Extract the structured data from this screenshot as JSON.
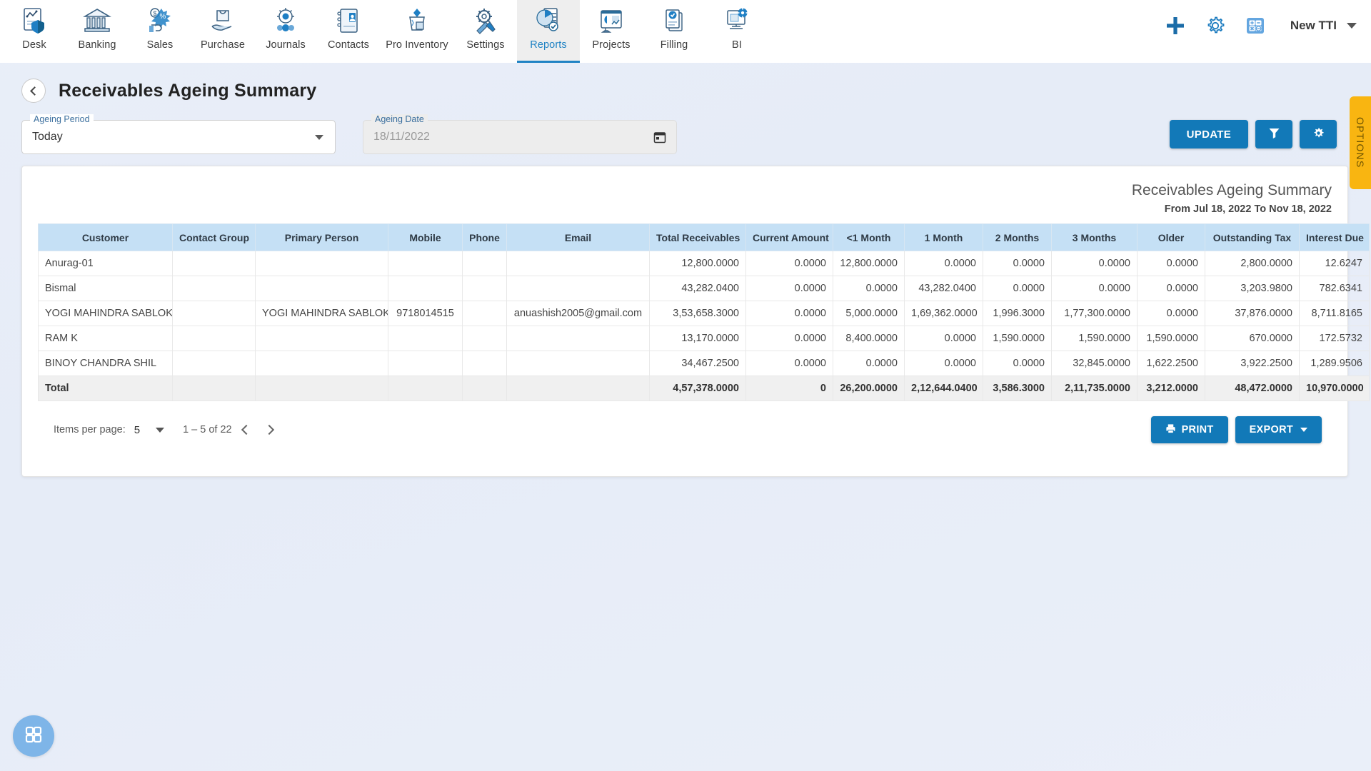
{
  "topnav": {
    "items": [
      {
        "label": "Desk",
        "icon": "desk-icon"
      },
      {
        "label": "Banking",
        "icon": "bank-icon"
      },
      {
        "label": "Sales",
        "icon": "sales-icon"
      },
      {
        "label": "Purchase",
        "icon": "purchase-icon"
      },
      {
        "label": "Journals",
        "icon": "journals-icon"
      },
      {
        "label": "Contacts",
        "icon": "contacts-icon"
      },
      {
        "label": "Pro Inventory",
        "icon": "inventory-icon"
      },
      {
        "label": "Settings",
        "icon": "settings-icon"
      },
      {
        "label": "Reports",
        "icon": "reports-icon"
      },
      {
        "label": "Projects",
        "icon": "projects-icon"
      },
      {
        "label": "Filling",
        "icon": "filling-icon"
      },
      {
        "label": "BI",
        "icon": "bi-icon"
      }
    ],
    "active_index": 8,
    "right": {
      "add_icon": "plus-icon",
      "settings_icon": "gear-icon",
      "calculator_icon": "calculator-icon",
      "company": "New TTI",
      "company_caret_icon": "chevron-down-icon"
    }
  },
  "header": {
    "back_icon": "chevron-left-icon",
    "title": "Receivables Ageing Summary"
  },
  "filters": {
    "ageing_period": {
      "label": "Ageing Period",
      "value": "Today"
    },
    "ageing_date": {
      "label": "Ageing Date",
      "value": "18/11/2022",
      "calendar_icon": "calendar-icon"
    },
    "update_label": "UPDATE",
    "filter_icon": "funnel-icon",
    "config_icon": "gear-icon"
  },
  "options_tab": {
    "label": "OPTIONS"
  },
  "report": {
    "title": "Receivables Ageing Summary",
    "subtitle": "From Jul 18, 2022 To Nov 18, 2022"
  },
  "table": {
    "columns": [
      "Customer",
      "Contact Group",
      "Primary Person",
      "Mobile",
      "Phone",
      "Email",
      "Total Receivables",
      "Current Amount",
      "<1 Month",
      "1 Month",
      "2 Months",
      "3 Months",
      "Older",
      "Outstanding Tax",
      "Interest Due"
    ],
    "rows": [
      {
        "customer": "Anurag-01",
        "contact_group": "",
        "primary_person": "",
        "mobile": "",
        "phone": "",
        "email": "",
        "total_receivables": "12,800.0000",
        "current_amount": "0.0000",
        "lt1_month": "12,800.0000",
        "m1": "0.0000",
        "m2": "0.0000",
        "m3": "0.0000",
        "older": "0.0000",
        "outstanding_tax": "2,800.0000",
        "interest_due": "12.6247"
      },
      {
        "customer": "Bismal",
        "contact_group": "",
        "primary_person": "",
        "mobile": "",
        "phone": "",
        "email": "",
        "total_receivables": "43,282.0400",
        "current_amount": "0.0000",
        "lt1_month": "0.0000",
        "m1": "43,282.0400",
        "m2": "0.0000",
        "m3": "0.0000",
        "older": "0.0000",
        "outstanding_tax": "3,203.9800",
        "interest_due": "782.6341"
      },
      {
        "customer": "YOGI MAHINDRA SABLOK",
        "contact_group": "",
        "primary_person": "YOGI MAHINDRA SABLOK",
        "mobile": "9718014515",
        "phone": "",
        "email": "anuashish2005@gmail.com",
        "total_receivables": "3,53,658.3000",
        "current_amount": "0.0000",
        "lt1_month": "5,000.0000",
        "m1": "1,69,362.0000",
        "m2": "1,996.3000",
        "m3": "1,77,300.0000",
        "older": "0.0000",
        "outstanding_tax": "37,876.0000",
        "interest_due": "8,711.8165"
      },
      {
        "customer": "RAM K",
        "contact_group": "",
        "primary_person": "",
        "mobile": "",
        "phone": "",
        "email": "",
        "total_receivables": "13,170.0000",
        "current_amount": "0.0000",
        "lt1_month": "8,400.0000",
        "m1": "0.0000",
        "m2": "1,590.0000",
        "m3": "1,590.0000",
        "older": "1,590.0000",
        "outstanding_tax": "670.0000",
        "interest_due": "172.5732"
      },
      {
        "customer": "BINOY CHANDRA SHIL",
        "contact_group": "",
        "primary_person": "",
        "mobile": "",
        "phone": "",
        "email": "",
        "total_receivables": "34,467.2500",
        "current_amount": "0.0000",
        "lt1_month": "0.0000",
        "m1": "0.0000",
        "m2": "0.0000",
        "m3": "32,845.0000",
        "older": "1,622.2500",
        "outstanding_tax": "3,922.2500",
        "interest_due": "1,289.9506"
      }
    ],
    "total": {
      "customer": "Total",
      "contact_group": "",
      "primary_person": "",
      "mobile": "",
      "phone": "",
      "email": "",
      "total_receivables": "4,57,378.0000",
      "current_amount": "0",
      "lt1_month": "26,200.0000",
      "m1": "2,12,644.0400",
      "m2": "3,586.3000",
      "m3": "2,11,735.0000",
      "older": "3,212.0000",
      "outstanding_tax": "48,472.0000",
      "interest_due": "10,970.0000"
    }
  },
  "footer": {
    "items_per_page_label": "Items per page:",
    "items_per_page_value": "5",
    "range_label": "1 – 5 of 22",
    "prev_icon": "chevron-left-icon",
    "next_icon": "chevron-right-icon",
    "print_label": "PRINT",
    "print_icon": "printer-icon",
    "export_label": "EXPORT"
  },
  "fab": {
    "icon": "grid-apps-icon"
  },
  "colors": {
    "accent": "#1279b8",
    "nav_active": "#2083c4",
    "table_header": "#c5e0f5",
    "options_tab": "#f9b511",
    "page_bg": "#e8edf8",
    "fab": "#7eb5e8"
  }
}
